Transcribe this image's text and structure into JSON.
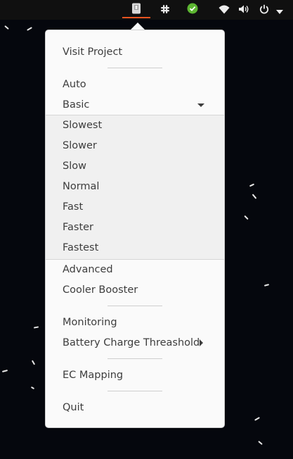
{
  "topbar": {
    "icons": [
      "fan-app-icon",
      "slack-icon",
      "green-check-icon",
      "wifi-icon",
      "volume-icon",
      "power-icon",
      "chevron-down-icon"
    ],
    "accent_color": "#e95420"
  },
  "menu": {
    "visit_project": "Visit Project",
    "auto": "Auto",
    "basic": "Basic",
    "speeds": [
      "Slowest",
      "Slower",
      "Slow",
      "Normal",
      "Fast",
      "Faster",
      "Fastest"
    ],
    "advanced": "Advanced",
    "cooler_booster": "Cooler Booster",
    "monitoring": "Monitoring",
    "battery_charge_threshold": "Battery Charge Threashold",
    "ec_mapping": "EC Mapping",
    "quit": "Quit"
  }
}
